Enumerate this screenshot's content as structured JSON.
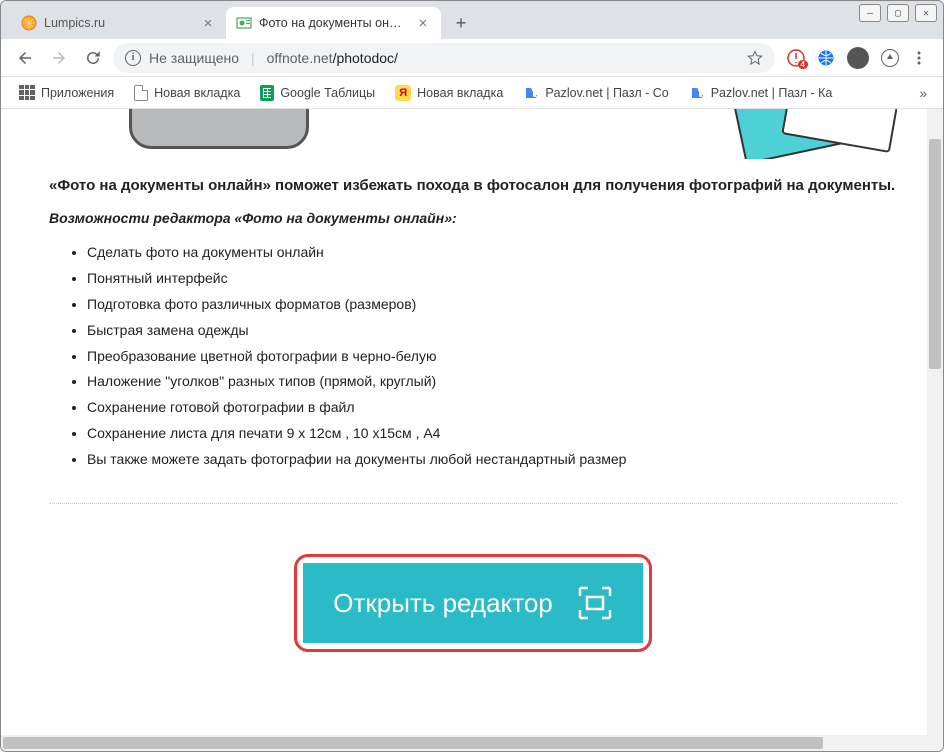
{
  "tabs": [
    {
      "title": "Lumpics.ru",
      "active": false
    },
    {
      "title": "Фото на документы онлайн",
      "active": true
    }
  ],
  "address": {
    "security_label": "Не защищено",
    "host": "offnote.net",
    "path": "/photodoc/"
  },
  "extension_badge": "4",
  "bookmarks": [
    {
      "label": "Приложения",
      "icon": "apps"
    },
    {
      "label": "Новая вкладка",
      "icon": "file"
    },
    {
      "label": "Google Таблицы",
      "icon": "sheets"
    },
    {
      "label": "Новая вкладка",
      "icon": "yandex"
    },
    {
      "label": "Pazlov.net | Пазл - Со",
      "icon": "puzzle"
    },
    {
      "label": "Pazlov.net | Пазл - Ка",
      "icon": "puzzle"
    }
  ],
  "page": {
    "heading": "«Фото на документы онлайн» поможет избежать похода в фотосалон для получения фотографий на документы.",
    "subheading": "Возможности редактора «Фото на документы онлайн»:",
    "features": [
      "Сделать фото на документы онлайн",
      "Понятный интерфейс",
      "Подготовка фото различных форматов (размеров)",
      "Быстрая замена одежды",
      "Преобразование цветной фотографии в черно-белую",
      "Наложение \"уголков\" разных типов (прямой, круглый)",
      "Сохранение готовой фотографии в файл",
      "Сохранение листа для печати 9 x 12см , 10 x15см , A4",
      "Вы также можете задать фотографии на документы любой нестандартный размер"
    ],
    "cta_label": "Открыть редактор"
  }
}
